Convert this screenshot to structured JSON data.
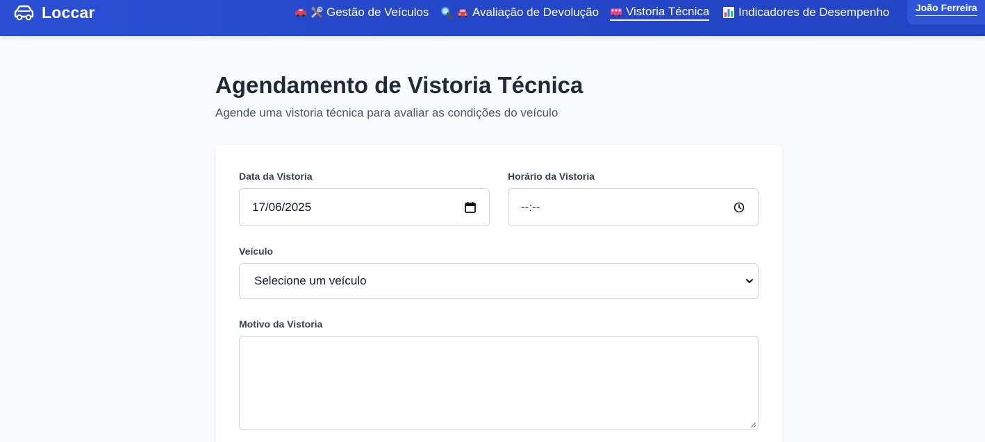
{
  "app": {
    "name": "Loccar"
  },
  "nav": {
    "items": [
      {
        "label": "Gestão de Veículos",
        "icons": [
          "car-icon",
          "tools-icon"
        ],
        "active": false
      },
      {
        "label": "Avaliação de Devolução",
        "icons": [
          "magnifier-icon",
          "car-front-icon"
        ],
        "active": false
      },
      {
        "label": "Vistoria Técnica",
        "icons": [
          "bus-icon"
        ],
        "active": true
      },
      {
        "label": "Indicadores de Desempenho",
        "icons": [
          "bar-chart-icon"
        ],
        "active": false
      }
    ]
  },
  "user": {
    "name": "João Ferreira"
  },
  "page": {
    "title": "Agendamento de Vistoria Técnica",
    "subtitle": "Agende uma vistoria técnica para avaliar as condições do veículo"
  },
  "form": {
    "date": {
      "label": "Data da Vistoria",
      "value": "17/06/2025",
      "icon": "calendar-icon"
    },
    "time": {
      "label": "Horário da Vistoria",
      "value": "--:--",
      "icon": "clock-icon"
    },
    "vehicle": {
      "label": "Veículo",
      "selected": "Selecione um veículo",
      "icon": "chevron-down-icon"
    },
    "reason": {
      "label": "Motivo da Vistoria",
      "value": ""
    }
  },
  "colors": {
    "navbar": "#2446c8",
    "background": "#f8fafc",
    "title": "#1f2937",
    "border": "#d1d5db"
  }
}
